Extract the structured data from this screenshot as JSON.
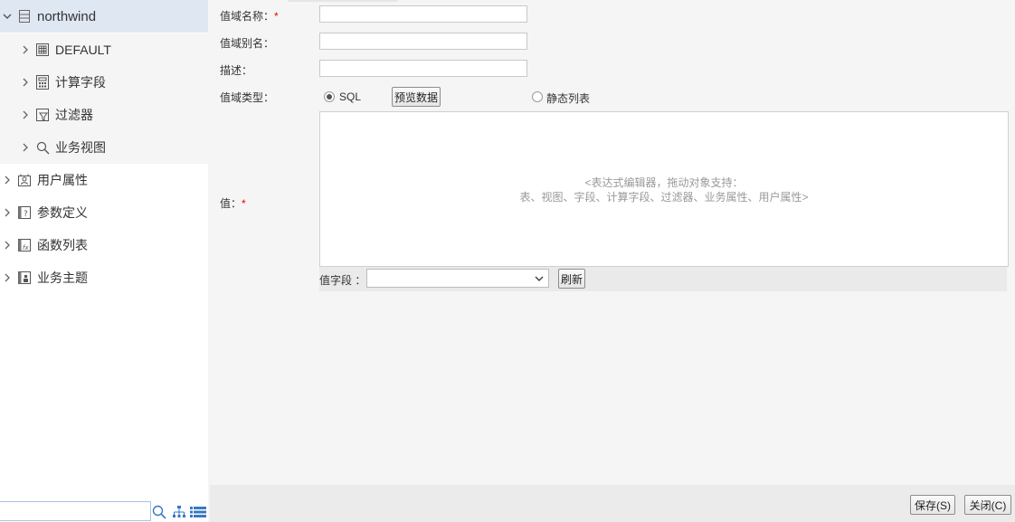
{
  "tree": {
    "root": {
      "label": "northwind",
      "icon": "database-icon"
    },
    "children": [
      {
        "label": "DEFAULT",
        "icon": "schema-icon"
      },
      {
        "label": "计算字段",
        "icon": "calc-field-icon"
      },
      {
        "label": "过滤器",
        "icon": "filter-icon"
      },
      {
        "label": "业务视图",
        "icon": "search-icon"
      }
    ],
    "topLevel": [
      {
        "label": "用户属性",
        "icon": "user-attribute-icon"
      },
      {
        "label": "参数定义",
        "icon": "parameter-icon"
      },
      {
        "label": "函数列表",
        "icon": "function-icon"
      },
      {
        "label": "业务主题",
        "icon": "business-theme-icon"
      }
    ],
    "search": {
      "value": "",
      "placeholder": ""
    },
    "tools": [
      "search-icon",
      "tree-view-icon",
      "list-view-icon"
    ]
  },
  "form": {
    "domain_name": {
      "label": "值域名称：",
      "required": "*",
      "value": ""
    },
    "domain_alias": {
      "label": "值域别名：",
      "value": ""
    },
    "description": {
      "label": "描述：",
      "value": ""
    },
    "domain_type": {
      "label": "值域类型：",
      "options": [
        {
          "label": "SQL",
          "checked": true
        },
        {
          "label": "静态列表",
          "checked": false
        }
      ],
      "preview_button": "预览数据"
    },
    "value": {
      "label": "值：",
      "required": "*",
      "hint_line1": "<表达式编辑器，拖动对象支持：",
      "hint_line2": "表、视图、字段、计算字段、过滤器、业务属性、用户属性>"
    },
    "value_field": {
      "label": "值字段 ：",
      "selected": "",
      "refresh_button": "刷新"
    }
  },
  "footer": {
    "save_button": "保存(S)",
    "close_button": "关闭(C)"
  },
  "colors": {
    "tree_selected_bg": "#dfe7f3",
    "required": "#e60000",
    "hint_text": "#999999"
  }
}
